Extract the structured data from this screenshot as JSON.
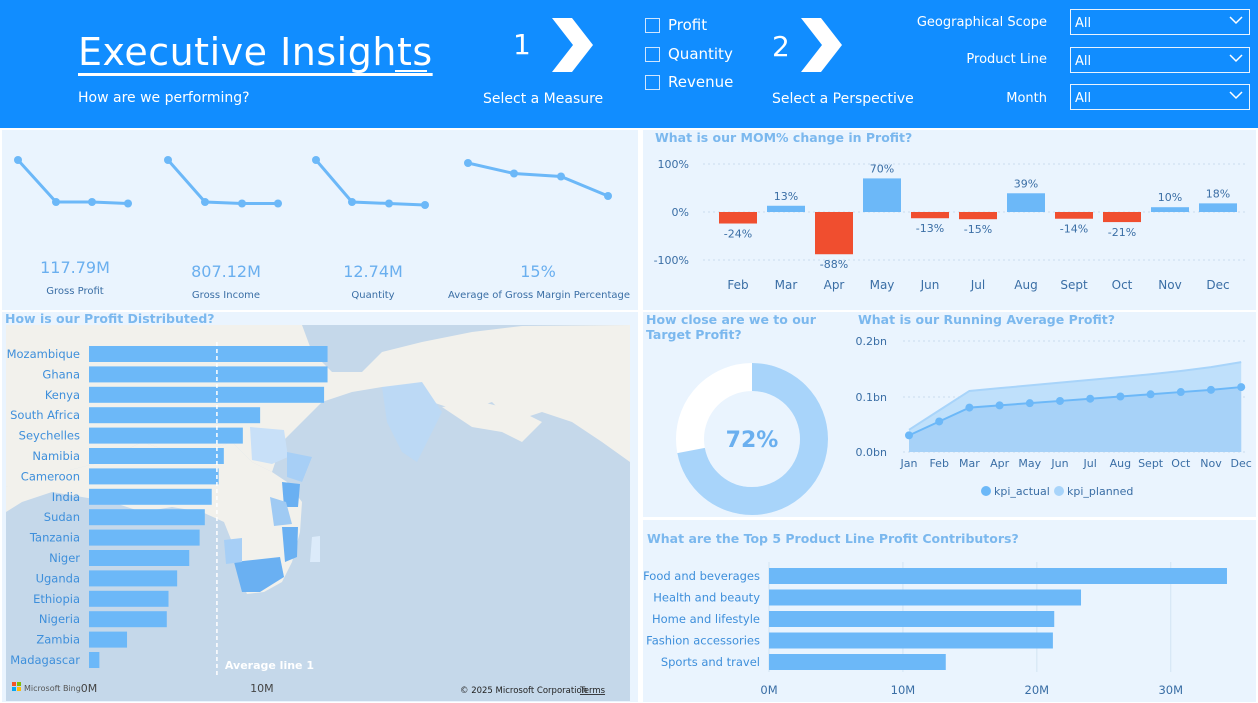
{
  "header": {
    "title": "Executive Insights",
    "subtitle": "How are we performing?",
    "step1_number": "1",
    "step1_label": "Select a Measure",
    "step2_number": "2",
    "step2_label": "Select a Perspective",
    "measures": [
      "Profit",
      "Quantity",
      "Revenue"
    ],
    "filters": [
      {
        "label": "Geographical Scope",
        "value": "All"
      },
      {
        "label": "Product Line",
        "value": "All"
      },
      {
        "label": "Month",
        "value": "All"
      }
    ]
  },
  "kpis": [
    {
      "value": "117.79M",
      "label": "Gross Profit",
      "trend": [
        4,
        1.2,
        1.2,
        1.1
      ]
    },
    {
      "value": "807.12M",
      "label": "Gross Income",
      "trend": [
        4,
        1.2,
        1.1,
        1.1
      ]
    },
    {
      "value": "12.74M",
      "label": "Quantity",
      "trend": [
        4,
        1.2,
        1.1,
        1.0
      ]
    },
    {
      "value": "15%",
      "label": "Average of Gross Margin Percentage",
      "trend": [
        3.8,
        3.1,
        2.9,
        1.6
      ]
    }
  ],
  "colors": {
    "header": "#118DFF",
    "panel": "#EAF4FE",
    "bar": "#6CB8F8",
    "negative": "#F04E2F",
    "light_bar": "#A8D4FA",
    "title_text": "#7BB8EE",
    "label_text": "#3A6EA5"
  },
  "chart_data": [
    {
      "id": "mom",
      "type": "bar",
      "title": "What is our MOM% change in Profit?",
      "categories": [
        "Feb",
        "Mar",
        "Apr",
        "May",
        "Jun",
        "Jul",
        "Aug",
        "Sept",
        "Oct",
        "Nov",
        "Dec"
      ],
      "values": [
        -24,
        13,
        -88,
        70,
        -13,
        -15,
        39,
        -14,
        -21,
        10,
        18
      ],
      "data_labels": [
        "-24%",
        "13%",
        "-88%",
        "70%",
        "-13%",
        "-15%",
        "39%",
        "-14%",
        "-21%",
        "10%",
        "18%"
      ],
      "yticks": [
        "100%",
        "0%",
        "-100%"
      ],
      "ylim": [
        -100,
        100
      ]
    },
    {
      "id": "geo",
      "type": "bar",
      "orientation": "horizontal",
      "title": "How is our Profit Distributed?",
      "categories": [
        "Mozambique",
        "Ghana",
        "Kenya",
        "South Africa",
        "Seychelles",
        "Namibia",
        "Cameroon",
        "India",
        "Sudan",
        "Tanzania",
        "Niger",
        "Uganda",
        "Ethiopia",
        "Nigeria",
        "Zambia",
        "Madagascar"
      ],
      "values": [
        13.8,
        13.8,
        13.6,
        9.9,
        8.9,
        7.8,
        7.5,
        7.1,
        6.7,
        6.4,
        5.8,
        5.1,
        4.6,
        4.5,
        2.2,
        0.6
      ],
      "xticks": [
        "0M",
        "10M"
      ],
      "xlim": [
        0,
        14
      ],
      "average_line": {
        "value": 7.4,
        "label": "Average line 1"
      },
      "map_attribution": "© 2025 Microsoft Corporation",
      "map_terms": "Terms",
      "map_brand": "Microsoft Bing"
    },
    {
      "id": "target",
      "type": "pie",
      "title": "How close are we to our Target Profit?",
      "values": [
        72,
        28
      ],
      "center_label": "72%"
    },
    {
      "id": "running",
      "type": "area",
      "title": "What is our Running Average Profit?",
      "x": [
        "Jan",
        "Feb",
        "Mar",
        "Apr",
        "May",
        "Jun",
        "Jul",
        "Aug",
        "Sept",
        "Oct",
        "Nov",
        "Dec"
      ],
      "series": [
        {
          "name": "kpi_actual",
          "values": [
            0.03,
            0.055,
            0.08,
            0.084,
            0.088,
            0.092,
            0.096,
            0.1,
            0.104,
            0.108,
            0.112,
            0.117
          ]
        },
        {
          "name": "kpi_planned",
          "values": [
            0.04,
            0.075,
            0.11,
            0.115,
            0.12,
            0.125,
            0.13,
            0.135,
            0.14,
            0.146,
            0.153,
            0.162
          ]
        }
      ],
      "yticks": [
        "0.2bn",
        "0.1bn",
        "0.0bn"
      ],
      "ylim": [
        0,
        0.2
      ],
      "legend": "bottom"
    },
    {
      "id": "products",
      "type": "bar",
      "orientation": "horizontal",
      "title": "What are the Top 5 Product Line Profit Contributors?",
      "categories": [
        "Food and beverages",
        "Health and beauty",
        "Home and lifestyle",
        "Fashion accessories",
        "Sports and travel"
      ],
      "values": [
        34.2,
        23.3,
        21.3,
        21.2,
        13.2
      ],
      "xticks": [
        "0M",
        "10M",
        "20M",
        "30M"
      ],
      "xlim": [
        0,
        34.5
      ]
    }
  ]
}
